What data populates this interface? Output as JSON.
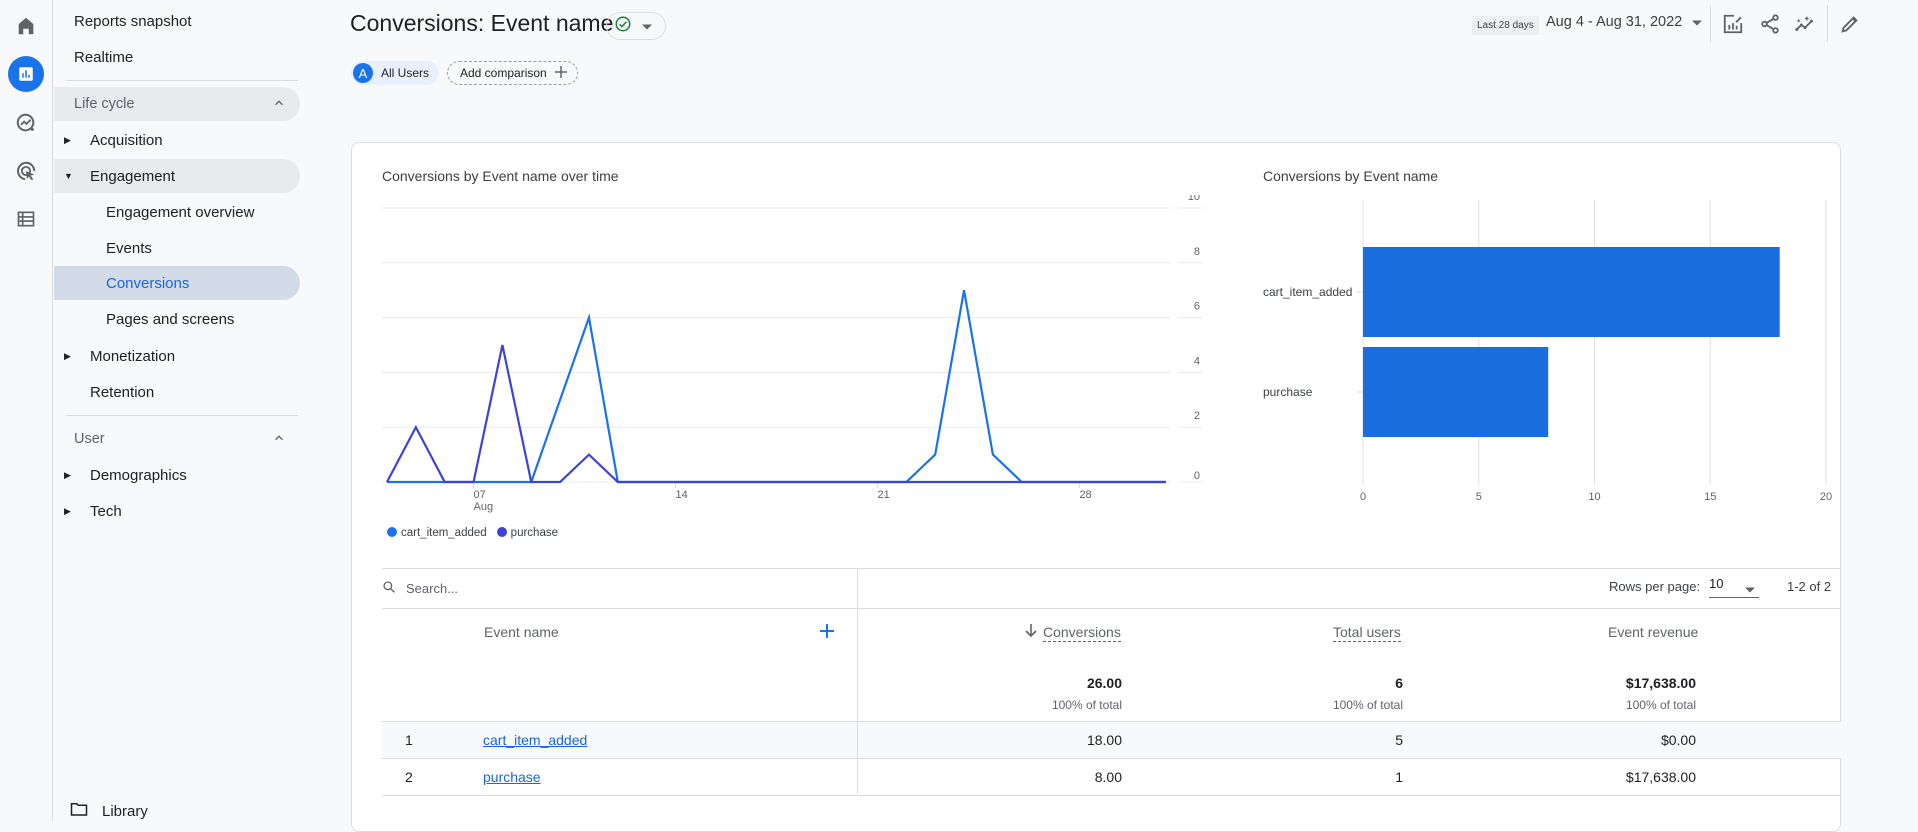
{
  "rail": {
    "icons": [
      "home-icon",
      "reports-icon",
      "explore-icon",
      "advertising-icon",
      "configure-icon"
    ]
  },
  "nav": {
    "top_items": [
      {
        "label": "Reports snapshot"
      },
      {
        "label": "Realtime"
      }
    ],
    "sections": [
      {
        "label": "Life cycle",
        "expanded": true,
        "items": [
          {
            "label": "Acquisition",
            "expandable": true,
            "expanded": false
          },
          {
            "label": "Engagement",
            "expandable": true,
            "expanded": true,
            "children": [
              {
                "label": "Engagement overview"
              },
              {
                "label": "Events"
              },
              {
                "label": "Conversions",
                "selected": true
              },
              {
                "label": "Pages and screens"
              }
            ]
          },
          {
            "label": "Monetization",
            "expandable": true,
            "expanded": false
          },
          {
            "label": "Retention",
            "expandable": false
          }
        ]
      },
      {
        "label": "User",
        "expanded": true,
        "items": [
          {
            "label": "Demographics",
            "expandable": true,
            "expanded": false
          },
          {
            "label": "Tech",
            "expandable": true,
            "expanded": false
          }
        ]
      }
    ],
    "library_label": "Library"
  },
  "header": {
    "title": "Conversions: Event name",
    "status": "check-circle",
    "comparison_chip": {
      "avatar": "A",
      "label": "All Users"
    },
    "add_comparison_label": "Add comparison",
    "date_preset": "Last 28 days",
    "date_range": "Aug 4 - Aug 31, 2022",
    "toolbar_icons": [
      "customize-report-icon",
      "share-icon",
      "insights-icon",
      "edit-icon"
    ]
  },
  "colors": {
    "accent": "#1a73e8",
    "cart_item_added": "#1a73e8",
    "purchase": "#3c44d6",
    "bar": "#1a6ddd",
    "check": "#188038"
  },
  "chart_data": [
    {
      "type": "line",
      "title": "Conversions by Event name over time",
      "x": [
        "Aug 4",
        "Aug 5",
        "Aug 6",
        "Aug 7",
        "Aug 8",
        "Aug 9",
        "Aug 10",
        "Aug 11",
        "Aug 12",
        "Aug 13",
        "Aug 14",
        "Aug 15",
        "Aug 16",
        "Aug 17",
        "Aug 18",
        "Aug 19",
        "Aug 20",
        "Aug 21",
        "Aug 22",
        "Aug 23",
        "Aug 24",
        "Aug 25",
        "Aug 26",
        "Aug 27",
        "Aug 28",
        "Aug 29",
        "Aug 30",
        "Aug 31"
      ],
      "x_ticks": [
        {
          "index": 3,
          "label": "07",
          "sublabel": "Aug"
        },
        {
          "index": 10,
          "label": "14"
        },
        {
          "index": 17,
          "label": "21"
        },
        {
          "index": 24,
          "label": "28"
        }
      ],
      "y_ticks": [
        0,
        2,
        4,
        6,
        8,
        10
      ],
      "ylim": [
        0,
        10
      ],
      "y_axis_side": "right",
      "grid": true,
      "legend_position": "bottom-left",
      "series": [
        {
          "name": "cart_item_added",
          "values": [
            0,
            0,
            0,
            0,
            0,
            0,
            3,
            6,
            0,
            0,
            0,
            0,
            0,
            0,
            0,
            0,
            0,
            0,
            0,
            1,
            7,
            1,
            0,
            0,
            0,
            0,
            0,
            0
          ]
        },
        {
          "name": "purchase",
          "values": [
            0,
            2,
            0,
            0,
            5,
            0,
            0,
            1,
            0,
            0,
            0,
            0,
            0,
            0,
            0,
            0,
            0,
            0,
            0,
            0,
            0,
            0,
            0,
            0,
            0,
            0,
            0,
            0
          ]
        }
      ]
    },
    {
      "type": "bar",
      "orientation": "horizontal",
      "title": "Conversions by Event name",
      "categories": [
        "cart_item_added",
        "purchase"
      ],
      "values": [
        18,
        8
      ],
      "x_ticks": [
        0,
        5,
        10,
        15,
        20
      ],
      "xlim": [
        0,
        20
      ],
      "grid": true
    }
  ],
  "table": {
    "search_placeholder": "Search...",
    "rows_per_page_label": "Rows per page:",
    "rows_per_page": "10",
    "pagination": "1-2 of 2",
    "columns": {
      "dimension": "Event name",
      "conversions": "Conversions",
      "total_users": "Total users",
      "event_revenue": "Event revenue"
    },
    "totals": {
      "conversions": "26.00",
      "conversions_pct": "100% of total",
      "total_users": "6",
      "total_users_pct": "100% of total",
      "event_revenue": "$17,638.00",
      "event_revenue_pct": "100% of total"
    },
    "rows": [
      {
        "index": "1",
        "event_name": "cart_item_added",
        "conversions": "18.00",
        "total_users": "5",
        "event_revenue": "$0.00"
      },
      {
        "index": "2",
        "event_name": "purchase",
        "conversions": "8.00",
        "total_users": "1",
        "event_revenue": "$17,638.00"
      }
    ]
  }
}
